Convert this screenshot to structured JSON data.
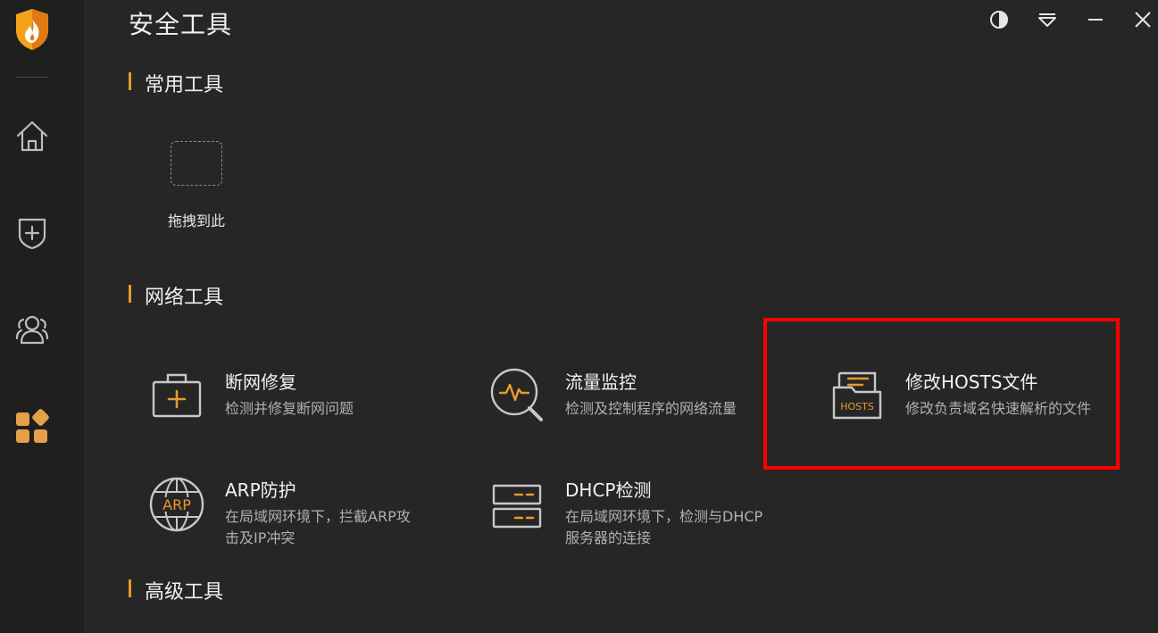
{
  "window": {
    "title": "安全工具",
    "controls": [
      "theme-icon",
      "menu-icon",
      "minimize-icon",
      "close-icon"
    ]
  },
  "sidebar": {
    "items": [
      {
        "icon": "home-icon"
      },
      {
        "icon": "shield-plus-icon"
      },
      {
        "icon": "users-icon"
      },
      {
        "icon": "apps-grid-icon",
        "active": true
      }
    ]
  },
  "sections": {
    "common": {
      "label": "常用工具"
    },
    "network": {
      "label": "网络工具"
    },
    "advanced": {
      "label": "高级工具"
    }
  },
  "dropslot": {
    "label": "拖拽到此"
  },
  "tools": {
    "repair": {
      "name": "断网修复",
      "desc": "检测并修复断网问题",
      "icon": "first-aid-kit-icon"
    },
    "traffic": {
      "name": "流量监控",
      "desc": "检测及控制程序的网络流量",
      "icon": "traffic-monitor-icon"
    },
    "hosts": {
      "name": "修改HOSTS文件",
      "desc": "修改负责域名快速解析的文件",
      "icon": "hosts-file-icon",
      "icon_text": "HOSTS"
    },
    "arp": {
      "name": "ARP防护",
      "desc_line1": "在局域网环境下，拦截ARP攻",
      "desc_line2": "击及IP冲突",
      "icon": "arp-globe-icon",
      "icon_text": "ARP"
    },
    "dhcp": {
      "name": "DHCP检测",
      "desc_line1": "在局域网环境下，检测与DHCP",
      "desc_line2": "服务器的连接",
      "icon": "dhcp-server-icon"
    }
  },
  "colors": {
    "accent": "#e89a2a",
    "background": "#262626",
    "sidebar": "#1f1f1f",
    "highlight": "#ff0000"
  }
}
